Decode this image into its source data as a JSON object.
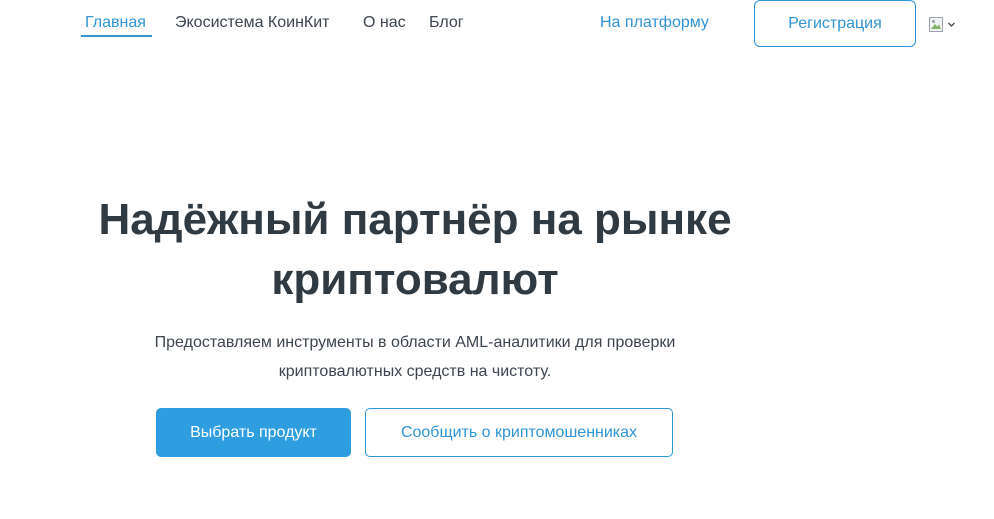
{
  "nav": {
    "items": [
      {
        "label": "Главная",
        "active": true
      },
      {
        "label": "Экосистема КоинКит",
        "active": false
      },
      {
        "label": "О нас",
        "active": false
      },
      {
        "label": "Блог",
        "active": false
      }
    ],
    "platform_link": "На платформу",
    "register_button": "Регистрация",
    "language_icon": "flag-icon",
    "language_dropdown_icon": "chevron-down-icon"
  },
  "hero": {
    "title_line1": "Надёжный партнёр на рынке",
    "title_line2": "криптовалют",
    "subtitle_line1": "Предоставляем инструменты в области AML-аналитики для проверки",
    "subtitle_line2": "криптовалютных средств на чистоту.",
    "primary_button": "Выбрать продукт",
    "secondary_button": "Сообщить о криптомошенниках"
  },
  "colors": {
    "accent": "#2f95d4",
    "primary_button_bg": "#2f9ee0",
    "heading": "#2f3a43",
    "text": "#3c4550"
  }
}
